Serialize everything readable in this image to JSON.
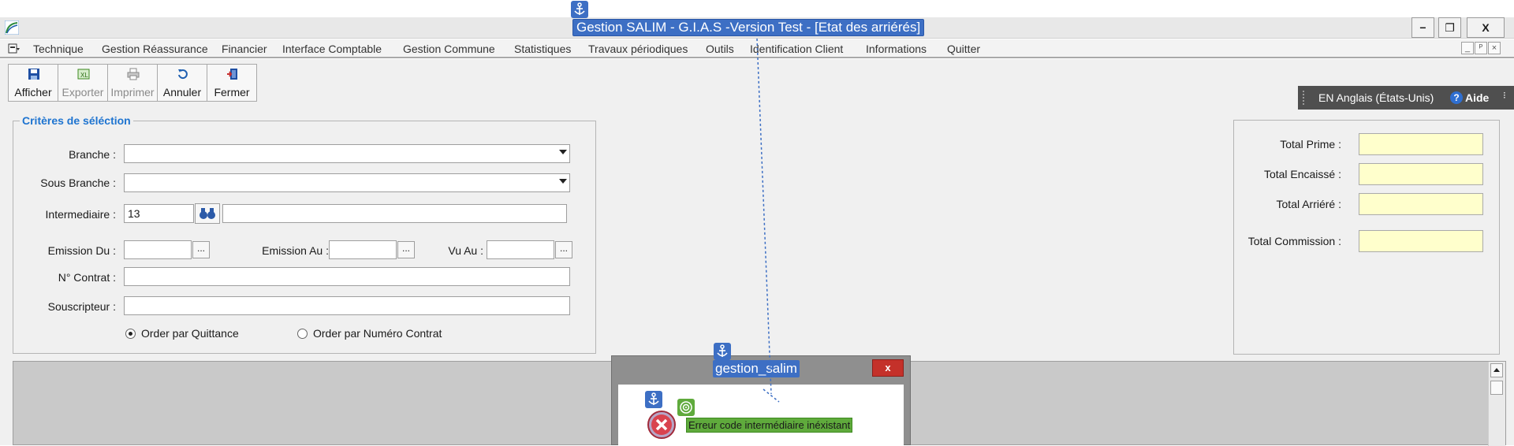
{
  "window": {
    "title": "Gestion  SALIM - G.I.A.S -Version Test - [Etat des arriérés]",
    "minimize": "−",
    "restore": "❐",
    "close": "X"
  },
  "menu": {
    "items": [
      "Technique",
      "Gestion Réassurance",
      "Financier",
      "Interface Comptable",
      "Gestion Commune",
      "Statistiques",
      "Travaux périodiques",
      "Outils",
      "Identification Client",
      "Informations",
      "Quitter"
    ],
    "mdi_minimize": "_",
    "mdi_restore": "ᴾ",
    "mdi_close": "×"
  },
  "toolbar": {
    "afficher": "Afficher",
    "exporter": "Exporter",
    "imprimer": "Imprimer",
    "annuler": "Annuler",
    "fermer": "Fermer"
  },
  "language_bar": {
    "language": "EN Anglais (États-Unis)",
    "help": "Aide"
  },
  "criteria": {
    "legend": "Critères de séléction",
    "branche_label": "Branche :",
    "branche_value": "",
    "sous_branche_label": "Sous Branche :",
    "sous_branche_value": "",
    "intermediaire_label": "Intermediaire :",
    "intermediaire_code": "13",
    "intermediaire_name": "",
    "emission_du_label": "Emission Du :",
    "emission_du_value": "",
    "emission_au_label": "Emission Au :",
    "emission_au_value": "",
    "vu_au_label": "Vu Au :",
    "vu_au_value": "",
    "dots": "...",
    "contrat_label": "N° Contrat :",
    "contrat_value": "",
    "souscripteur_label": "Souscripteur :",
    "souscripteur_value": "",
    "radio_quittance": "Order par Quittance",
    "radio_contrat": "Order par Numéro Contrat",
    "selected_order": "quittance"
  },
  "totals": {
    "prime_label": "Total Prime :",
    "encaisse_label": "Total  Encaissé :",
    "arriere_label": "Total Arriéré :",
    "commission_label": "Total Commission :",
    "prime_value": "",
    "encaisse_value": "",
    "arriere_value": "",
    "commission_value": ""
  },
  "dialog": {
    "title": "gestion_salim",
    "close": "x",
    "message": "Erreur code intermédiaire inéxistant"
  },
  "colors": {
    "highlight_blue": "#3d6fc4",
    "highlight_green": "#5faa3c",
    "total_field_bg": "#ffffcc",
    "legend_blue": "#1e74d0"
  },
  "icons": {
    "anchor": "anchor-icon",
    "target": "target-icon",
    "error": "error-icon"
  }
}
